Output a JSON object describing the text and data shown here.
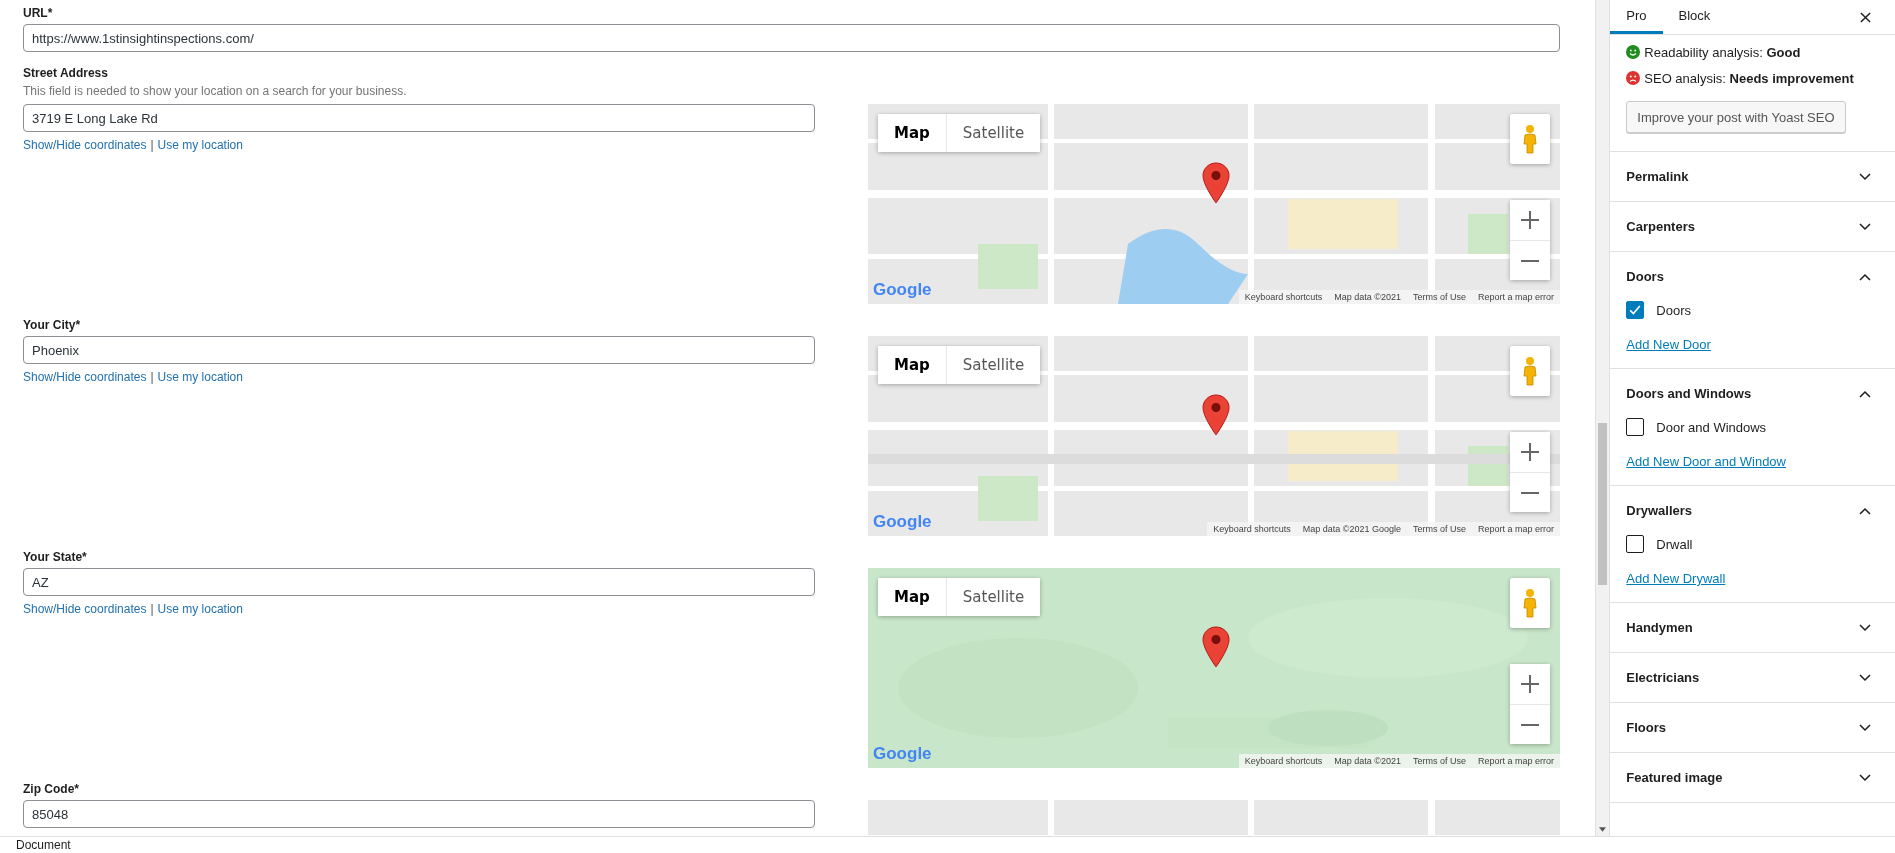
{
  "fields": [
    {
      "label": "URL*",
      "value": "https://www.1stinsightinspections.com/"
    },
    {
      "label": "Street Address",
      "description": "This field is needed to show your location on a search for your business.",
      "value": "3719 E Long Lake Rd",
      "links": [
        "Show/Hide coordinates",
        "Use my location"
      ],
      "map": {
        "kind": "picture",
        "map_types": [
          {
            "label": "Map",
            "selected": true
          },
          {
            "label": "Satellite",
            "selected": false
          }
        ],
        "logo": "Google",
        "footer": [
          "Keyboard shortcuts",
          "Map data ©2021",
          "Terms of Use",
          "Report a map error"
        ]
      }
    },
    {
      "label": "Your City*",
      "value": "Phoenix",
      "links": [
        "Show/Hide coordinates",
        "Use my location"
      ],
      "map": {
        "kind": "picture",
        "map_types": [
          {
            "label": "Map",
            "selected": true
          },
          {
            "label": "Satellite",
            "selected": false
          }
        ],
        "logo": "Google",
        "footer": [
          "Keyboard shortcuts",
          "Map data ©2021 Google",
          "Terms of Use",
          "Report a map error"
        ]
      }
    },
    {
      "label": "Your State*",
      "value": "AZ",
      "links": [
        "Show/Hide coordinates",
        "Use my location"
      ],
      "map": {
        "kind": "picture",
        "map_types": [
          {
            "label": "Map",
            "selected": true
          },
          {
            "label": "Satellite",
            "selected": false
          }
        ],
        "logo": "Google",
        "footer": [
          "Keyboard shortcuts",
          "Map data ©2021",
          "Terms of Use",
          "Report a map error"
        ]
      }
    },
    {
      "label": "Zip Code*",
      "value": "85048"
    }
  ],
  "link_separator": "|",
  "sidebar": {
    "tabs": [
      {
        "label": "Pro",
        "selected": true
      },
      {
        "label": "Block",
        "selected": false
      }
    ],
    "analyses": [
      {
        "text": "Readability analysis: **Good**",
        "kind": "good",
        "color": "#1e8c1e"
      },
      {
        "text": "SEO analysis: **Needs improvement**",
        "kind": "bad",
        "color": "#dc3232"
      }
    ],
    "improve_button": "Improve your post with Yoast SEO",
    "panels": [
      {
        "title": "Permalink",
        "expanded": false
      },
      {
        "title": "Carpenters",
        "expanded": false
      },
      {
        "title": "Doors",
        "expanded": true,
        "items": [
          {
            "label": "Doors",
            "checked": true
          }
        ],
        "add_link": "Add New Door"
      },
      {
        "title": "Doors and Windows",
        "expanded": true,
        "items": [
          {
            "label": "Door and Windows",
            "checked": false
          }
        ],
        "add_link": "Add New Door and Window"
      },
      {
        "title": "Drywallers",
        "expanded": true,
        "items": [
          {
            "label": "Drwall",
            "checked": false
          }
        ],
        "add_link": "Add New Drywall"
      },
      {
        "title": "Handymen",
        "expanded": false
      },
      {
        "title": "Electricians",
        "expanded": false
      },
      {
        "title": "Floors",
        "expanded": false
      },
      {
        "title": "Featured image",
        "expanded": false
      }
    ]
  },
  "status_bar": "Document"
}
